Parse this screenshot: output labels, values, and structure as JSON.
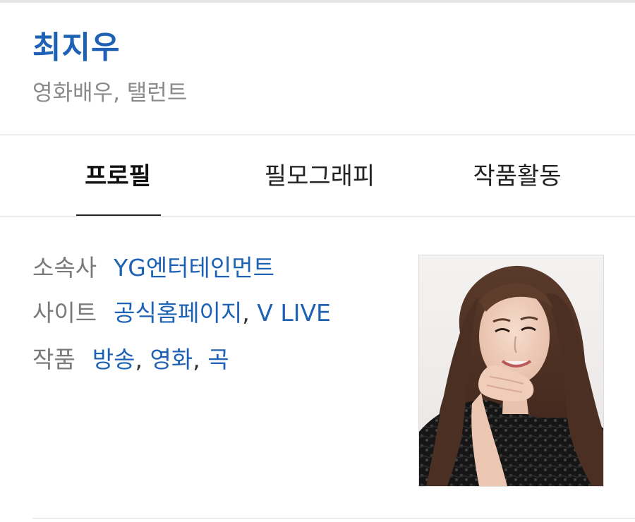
{
  "person": {
    "name": "최지우",
    "occupation": "영화배우, 탤런트"
  },
  "tabs": [
    {
      "label": "프로필",
      "active": true
    },
    {
      "label": "필모그래피",
      "active": false
    },
    {
      "label": "작품활동",
      "active": false
    }
  ],
  "info": {
    "agency": {
      "label": "소속사",
      "value": "YG엔터테인먼트"
    },
    "site": {
      "label": "사이트",
      "links": [
        "공식홈페이지",
        "V LIVE"
      ]
    },
    "works": {
      "label": "작품",
      "links": [
        "방송",
        "영화",
        "곡"
      ]
    }
  },
  "separator": ",",
  "colors": {
    "link": "#1d62b5",
    "label": "#7a7a7a",
    "subtitle": "#8a8a8a",
    "divider": "#ececec"
  }
}
